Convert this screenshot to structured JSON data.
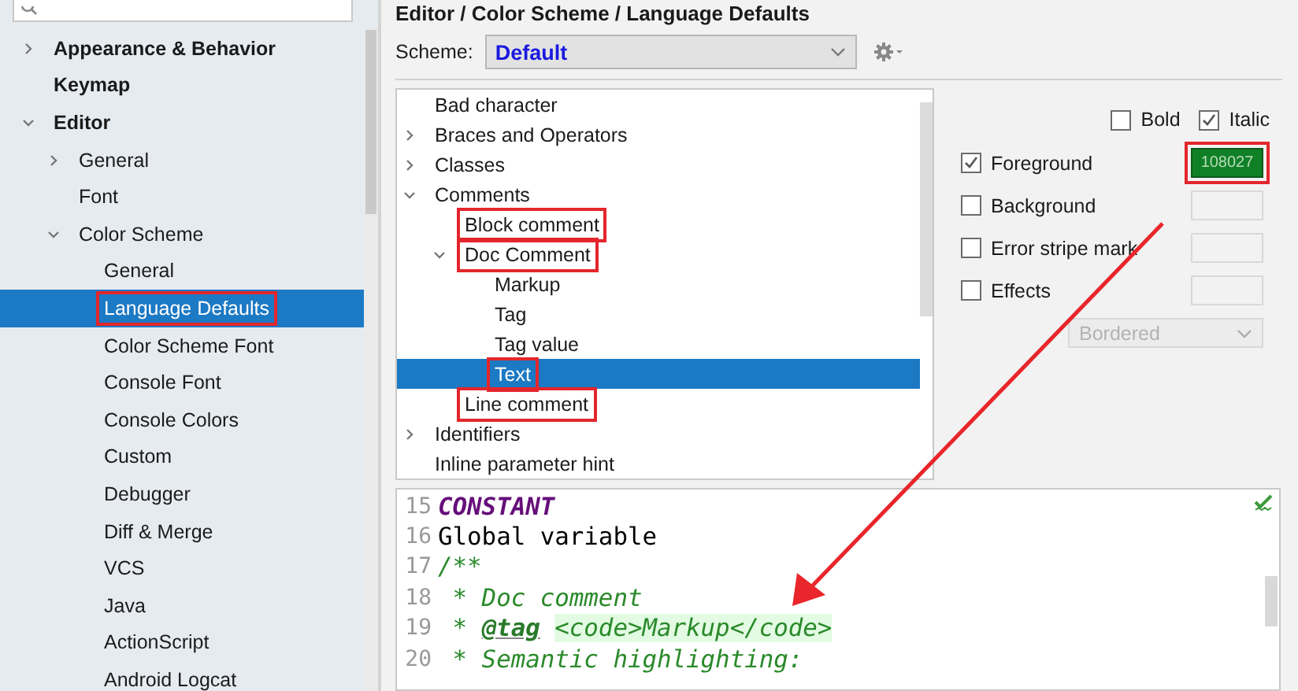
{
  "sidebar": {
    "items": [
      {
        "label": "Appearance & Behavior",
        "expanded": false,
        "selected": false,
        "highlighted": false
      },
      {
        "label": "Keymap",
        "selected": false,
        "highlighted": false
      },
      {
        "label": "Editor",
        "expanded": true,
        "selected": false,
        "highlighted": false,
        "children": [
          {
            "label": "General",
            "expanded": false,
            "selected": false,
            "highlighted": false
          },
          {
            "label": "Font",
            "selected": false,
            "highlighted": false
          },
          {
            "label": "Color Scheme",
            "expanded": true,
            "selected": false,
            "highlighted": false,
            "children": [
              {
                "label": "General",
                "selected": false,
                "highlighted": false
              },
              {
                "label": "Language Defaults",
                "selected": true,
                "highlighted": true
              },
              {
                "label": "Color Scheme Font",
                "selected": false,
                "highlighted": false
              },
              {
                "label": "Console Font",
                "selected": false,
                "highlighted": false
              },
              {
                "label": "Console Colors",
                "selected": false,
                "highlighted": false
              },
              {
                "label": "Custom",
                "selected": false,
                "highlighted": false
              },
              {
                "label": "Debugger",
                "selected": false,
                "highlighted": false
              },
              {
                "label": "Diff & Merge",
                "selected": false,
                "highlighted": false
              },
              {
                "label": "VCS",
                "selected": false,
                "highlighted": false
              },
              {
                "label": "Java",
                "selected": false,
                "highlighted": false
              },
              {
                "label": "ActionScript",
                "selected": false,
                "highlighted": false
              },
              {
                "label": "Android Logcat",
                "selected": false,
                "highlighted": false
              }
            ]
          }
        ]
      }
    ]
  },
  "breadcrumb": "Editor / Color Scheme / Language Defaults",
  "scheme": {
    "label": "Scheme:",
    "value": "Default"
  },
  "attributes_tree": {
    "items": [
      {
        "label": "Bad character",
        "selected": false,
        "highlighted": false
      },
      {
        "label": "Braces and Operators",
        "expanded": false,
        "selected": false,
        "highlighted": false
      },
      {
        "label": "Classes",
        "expanded": false,
        "selected": false,
        "highlighted": false
      },
      {
        "label": "Comments",
        "expanded": true,
        "selected": false,
        "highlighted": false,
        "children": [
          {
            "label": "Block comment",
            "selected": false,
            "highlighted": true
          },
          {
            "label": "Doc Comment",
            "expanded": true,
            "selected": false,
            "highlighted": true,
            "children": [
              {
                "label": "Markup",
                "selected": false,
                "highlighted": false
              },
              {
                "label": "Tag",
                "selected": false,
                "highlighted": false
              },
              {
                "label": "Tag value",
                "selected": false,
                "highlighted": false
              },
              {
                "label": "Text",
                "selected": true,
                "highlighted": true
              }
            ]
          },
          {
            "label": "Line comment",
            "selected": false,
            "highlighted": true
          }
        ]
      },
      {
        "label": "Identifiers",
        "expanded": false,
        "selected": false,
        "highlighted": false
      },
      {
        "label": "Inline parameter hint",
        "selected": false,
        "highlighted": false
      }
    ]
  },
  "font_style": [
    {
      "label": "Bold",
      "checked": false
    },
    {
      "label": "Italic",
      "checked": true
    }
  ],
  "attributes": [
    {
      "label": "Foreground",
      "checked": true,
      "value": "108027",
      "color": "#108027",
      "highlighted": true
    },
    {
      "label": "Background",
      "checked": false,
      "highlighted": false
    },
    {
      "label": "Error stripe mark",
      "checked": false,
      "highlighted": false
    },
    {
      "label": "Effects",
      "checked": false,
      "highlighted": false
    }
  ],
  "effect_dropdown": {
    "value": "Bordered",
    "disabled": true
  },
  "preview": {
    "lines": [
      {
        "number": "15",
        "tokens": [
          {
            "kind": "constant",
            "text": "CONSTANT"
          }
        ]
      },
      {
        "number": "16",
        "tokens": [
          {
            "kind": "plain",
            "text": "Global variable"
          }
        ]
      },
      {
        "number": "17",
        "tokens": [
          {
            "kind": "comment",
            "text": "/**"
          }
        ]
      },
      {
        "number": "18",
        "tokens": [
          {
            "kind": "comment",
            "text": " * Doc comment"
          }
        ]
      },
      {
        "number": "19",
        "tokens": [
          {
            "kind": "comment",
            "text": " * "
          },
          {
            "kind": "tag",
            "text": "@tag"
          },
          {
            "kind": "markup",
            "text": "<code>Markup</code>"
          }
        ]
      },
      {
        "number": "20",
        "tokens": [
          {
            "kind": "comment",
            "text": " * Semantic highlighting:"
          }
        ]
      }
    ]
  }
}
